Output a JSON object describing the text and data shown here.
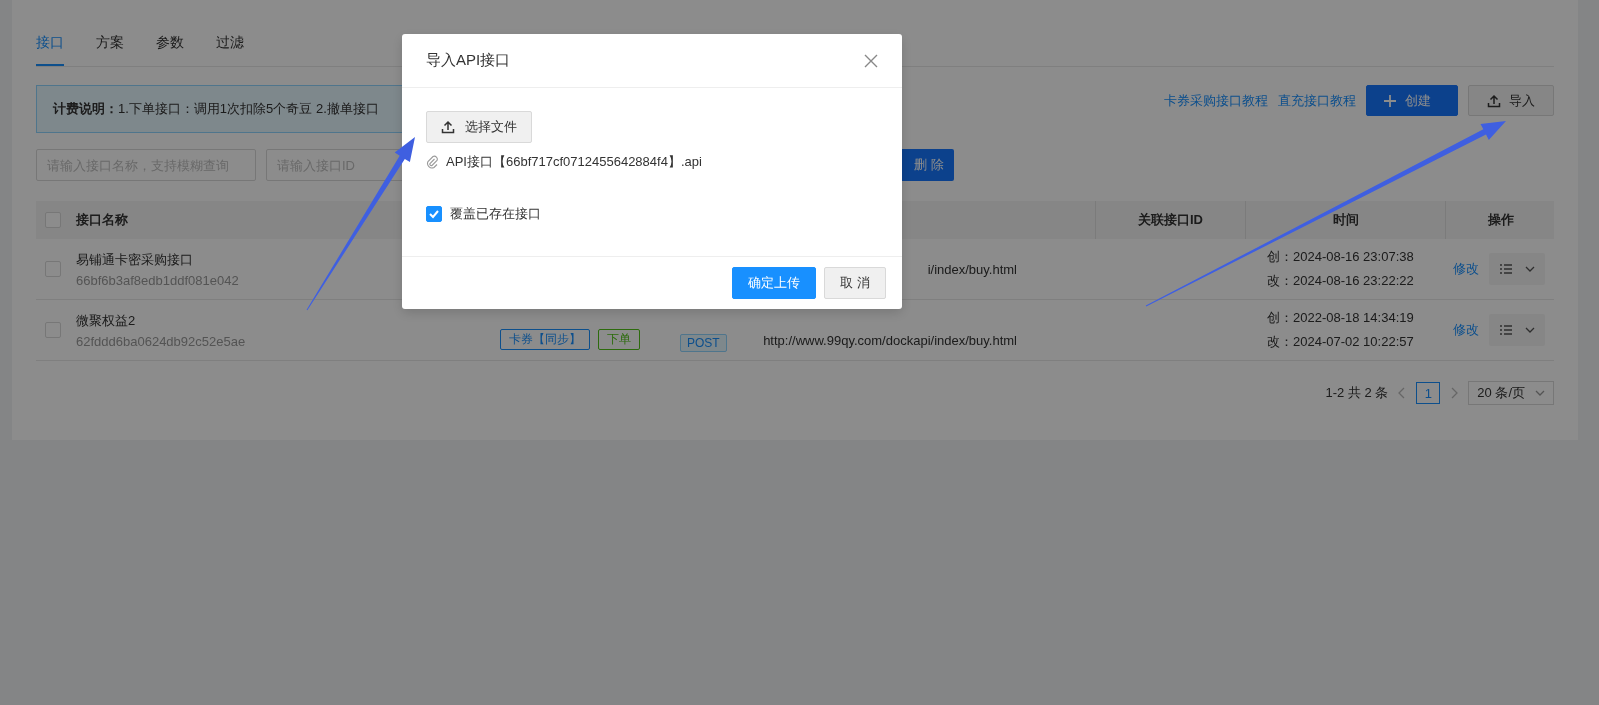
{
  "tabs": [
    {
      "label": "接口",
      "selected": true
    },
    {
      "label": "方案",
      "selected": false
    },
    {
      "label": "参数",
      "selected": false
    },
    {
      "label": "过滤",
      "selected": false
    }
  ],
  "notice": {
    "text": "**计费说明：**1.下单接口：调用1次扣除5个奇豆  2.撤单接口"
  },
  "links": [
    "卡券采购接口教程",
    "直充接口教程"
  ],
  "actions": [
    {
      "kind": "create",
      "label": "创建"
    },
    {
      "kind": "import",
      "label": "导入"
    }
  ],
  "filters": [
    {
      "placeholder": "请输入接口名称，支持模糊查询"
    },
    {
      "placeholder": "请输入接口ID"
    }
  ],
  "delete_button": {
    "label": "删 除"
  },
  "table": {
    "select_all_checked": false,
    "columns": {
      "name": "接口名称",
      "related_id": "关联接口ID",
      "time": "时间",
      "actions": "操作"
    },
    "rows": [
      {
        "checked": false,
        "name": "易铺通卡密采购接口",
        "id": "66bf6b3af8edb1ddf081e042",
        "url": "i/index/buy.html",
        "created": "创：2024-08-16 23:07:38",
        "modified": "改：2024-08-16 23:22:22",
        "action": "修改"
      },
      {
        "checked": false,
        "name": "微聚权益2",
        "id": "62fddd6ba0624db92c52e5ae",
        "tags": [
          {
            "label": "卡券【同步】",
            "color": "#0d4f8c"
          },
          {
            "label": "下单",
            "color": "#2d6c0e"
          }
        ],
        "method": "POST",
        "url": "http://www.99qy.com/dockapi/index/buy.html",
        "created": "创：2022-08-18 14:34:19",
        "modified": "改：2024-07-02 10:22:57",
        "action": "修改"
      }
    ]
  },
  "pagination": {
    "summary": "1-2 共 2 条",
    "pages": [
      {
        "label": "1",
        "selected": true
      }
    ],
    "page_size": "20 条/页"
  },
  "dialog": {
    "title": "导入API接口",
    "upload_button": "选择文件",
    "file": "API接口【66bf717cf0712455642884f4】.api",
    "overwrite": {
      "label": "覆盖已存在接口",
      "checked": true
    },
    "buttons": [
      {
        "kind": "primary",
        "label": "确定上传"
      },
      {
        "kind": "default",
        "label": "取 消"
      }
    ]
  }
}
